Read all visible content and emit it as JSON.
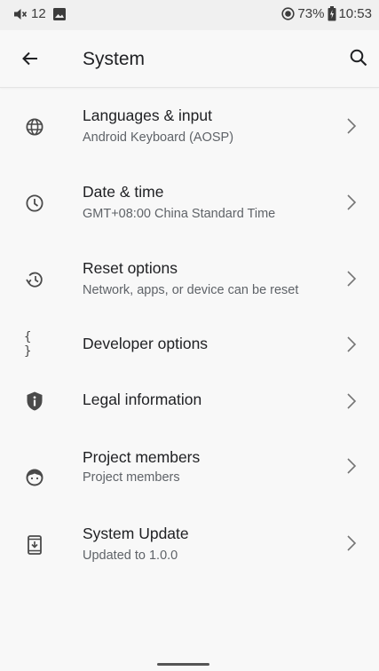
{
  "status_bar": {
    "notification_count": "12",
    "battery": "73%",
    "time": "10:53",
    "icons": [
      "volume-icon",
      "image-icon",
      "record-icon",
      "battery-icon"
    ]
  },
  "app_bar": {
    "title": "System",
    "icons": [
      "back-arrow-icon",
      "search-icon"
    ]
  },
  "items": [
    {
      "title": "Languages & input",
      "subtitle": "Android Keyboard (AOSP)",
      "icon": "globe-icon"
    },
    {
      "title": "Date & time",
      "subtitle": "GMT+08:00 China Standard Time",
      "icon": "clock-icon"
    },
    {
      "title": "Reset options",
      "subtitle": "Network, apps, or device can be reset",
      "icon": "restore-icon"
    },
    {
      "title": "Developer options",
      "subtitle": "",
      "icon": "braces-icon",
      "icon_glyph": "{ }"
    },
    {
      "title": "Legal information",
      "subtitle": "",
      "icon": "shield-info-icon"
    },
    {
      "title": "Project members",
      "subtitle": "Project members",
      "icon": "face-icon"
    },
    {
      "title": "System Update",
      "subtitle": "Updated to  1.0.0",
      "icon": "system-update-icon"
    }
  ],
  "colors": {
    "background": "#f8f8f8",
    "status_bar": "#f0f0f0",
    "primary_text": "#202124",
    "secondary_text": "#5f6368",
    "icon": "#4a4a4a"
  }
}
